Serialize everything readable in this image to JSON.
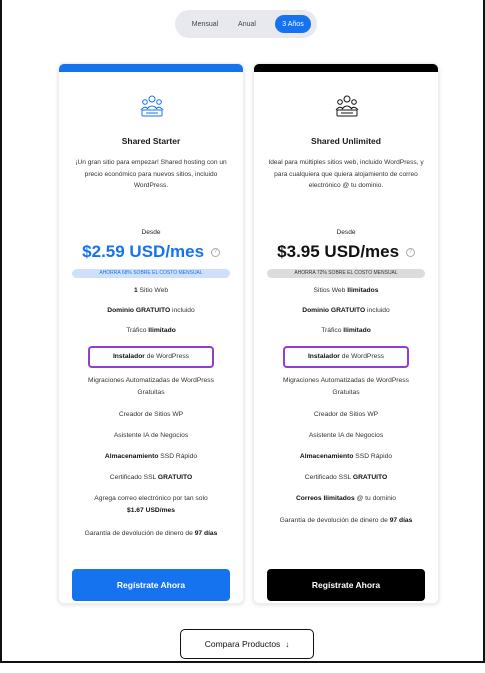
{
  "billing_toggle": {
    "options": [
      "Mensual",
      "Anual",
      "3 Años"
    ],
    "selected": "3 Años"
  },
  "plans": [
    {
      "name": "Shared Starter",
      "description": "¡Un gran sitio para empezar! Shared hosting con un precio económico para nuevos sitios, incluido WordPress.",
      "from_label": "Desde",
      "price": "$2.59 USD/mes",
      "savings": "AHORRA 68% SOBRE EL COSTO MENSUAL",
      "accent_color": "#1673f0",
      "features": [
        {
          "pre": "",
          "bold": "1",
          "post": " Sitio Web"
        },
        {
          "pre": "",
          "bold": "Dominio GRATUITO",
          "post": " incluido"
        },
        {
          "pre": "Tráfico ",
          "bold": "Ilimitado",
          "post": ""
        },
        {
          "pre": "",
          "bold": "Instalador",
          "post": " de WordPress"
        },
        {
          "pre": "Migraciones Automatizadas de WordPress Gratuitas",
          "bold": "",
          "post": ""
        },
        {
          "pre": "Creador de Sitios WP",
          "bold": "",
          "post": ""
        },
        {
          "pre": "Asistente IA de Negocios",
          "bold": "",
          "post": ""
        },
        {
          "pre": "",
          "bold": "Almacenamiento",
          "post": " SSD Rápido"
        },
        {
          "pre": "Certificado SSL ",
          "bold": "GRATUITO",
          "post": ""
        },
        {
          "pre": "Agrega correo electrónico por tan solo ",
          "bold": "$1.67 USD/mes",
          "post": ""
        },
        {
          "pre": "Garantía de devolución de dinero de ",
          "bold": "97 días",
          "post": ""
        }
      ],
      "cta": "Regístrate Ahora"
    },
    {
      "name": "Shared Unlimited",
      "description": "Ideal para múltiples sitios web, incluido WordPress, y para cualquiera que quiera alojamiento de correo electrónico @ tu dominio.",
      "from_label": "Desde",
      "price": "$3.95 USD/mes",
      "savings": "AHORRA 72% SOBRE EL COSTO MENSUAL",
      "accent_color": "#000000",
      "features": [
        {
          "pre": "Sitios Web ",
          "bold": "Ilimitados",
          "post": ""
        },
        {
          "pre": "",
          "bold": "Dominio GRATUITO",
          "post": " incluido"
        },
        {
          "pre": "Tráfico ",
          "bold": "Ilimitado",
          "post": ""
        },
        {
          "pre": "",
          "bold": "Instalador",
          "post": " de WordPress"
        },
        {
          "pre": "Migraciones Automatizadas de WordPress Gratuitas",
          "bold": "",
          "post": ""
        },
        {
          "pre": "Creador de Sitios WP",
          "bold": "",
          "post": ""
        },
        {
          "pre": "Asistente IA de Negocios",
          "bold": "",
          "post": ""
        },
        {
          "pre": "",
          "bold": "Almacenamiento",
          "post": " SSD Rápido"
        },
        {
          "pre": "Certificado SSL ",
          "bold": "GRATUITO",
          "post": ""
        },
        {
          "pre": "",
          "bold": "Correos Ilimitados",
          "post": " @ tu dominio"
        },
        {
          "pre": "Garantía de devolución de dinero de ",
          "bold": "97 días",
          "post": ""
        }
      ],
      "cta": "Regístrate Ahora"
    }
  ],
  "highlight_color": "#8e3dd6",
  "compare_button": "Compara Productos"
}
